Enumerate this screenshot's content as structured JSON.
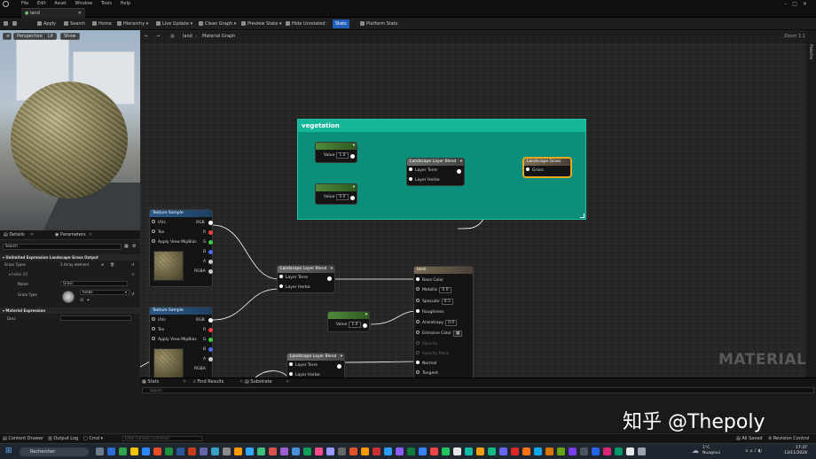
{
  "menubar": {
    "items": [
      "File",
      "Edit",
      "Asset",
      "Window",
      "Tools",
      "Help"
    ]
  },
  "document_tab": {
    "label": "land"
  },
  "toolbar": {
    "apply": "Apply",
    "search": "Search",
    "home": "Home",
    "hierarchy": "Hierarchy",
    "live_update": "Live Update",
    "clean_graph": "Clean Graph",
    "preview_state": "Preview State",
    "hide_unrelated": "Hide Unrelated",
    "stats": "Stats",
    "platform_stats": "Platform Stats"
  },
  "viewport": {
    "perspective": "Perspective",
    "lit": "Lit",
    "show": "Show"
  },
  "details_panel": {
    "tab_details": "Details",
    "tab_parameters": "Parameters",
    "search_placeholder": "Search",
    "section_main": "Unlimited Expression Landscape Grass Output",
    "grass_types_label": "Grass Types",
    "grass_types_value": "1 Array element",
    "index_label": "Index [0]",
    "name_label": "Name",
    "name_value": "Grass",
    "grass_type_label": "Grass Type",
    "grass_type_value": "herbe",
    "section_expression": "Material Expression",
    "desc_label": "Desc"
  },
  "graph": {
    "breadcrumb_root": "land",
    "breadcrumb_current": "Material Graph",
    "zoom": "Zoom 1:1",
    "palette": "Palette",
    "watermark": "MATERIAL"
  },
  "comment_box": {
    "title": "vegetation"
  },
  "nodes": {
    "const1": {
      "pin": "Value",
      "value": "1.0"
    },
    "const2": {
      "pin": "Value",
      "value": "0.0"
    },
    "const3": {
      "pin": "Value",
      "value": "1.0"
    },
    "blend_top": {
      "title": "Landscape Layer Blend",
      "pin1": "Layer Terre",
      "pin2": "Layer Herbe"
    },
    "blend_mid": {
      "title": "Landscape Layer Blend",
      "pin1": "Layer Terre",
      "pin2": "Layer Herbe"
    },
    "blend_bot": {
      "title": "Landscape Layer Blend",
      "pin1": "Layer Terre",
      "pin2": "Layer Herbe"
    },
    "grass_out": {
      "title": "Landscape Grass",
      "pin": "Grass"
    },
    "tex1": {
      "title": "Texture Sample",
      "uvs": "UVs",
      "tex": "Tex",
      "apply_mip": "Apply View MipBias",
      "rgb": "RGB",
      "r": "R",
      "g": "G",
      "b": "B",
      "a": "A",
      "rgba": "RGBA"
    },
    "tex2": {
      "title": "Texture Sample",
      "uvs": "UVs",
      "tex": "Tex",
      "apply_mip": "Apply View MipBias",
      "rgb": "RGB",
      "r": "R",
      "g": "G",
      "b": "B",
      "a": "A",
      "rgba": "RGBA"
    },
    "material": {
      "title": "land",
      "base_color": "Base Color",
      "metallic": "Metallic",
      "metallic_val": "0.0",
      "specular": "Specular",
      "specular_val": "0.5",
      "roughness": "Roughness",
      "anisotropy": "Anisotropy",
      "anisotropy_val": "0.0",
      "emissive": "Emissive Color",
      "opacity": "Opacity",
      "opacity_mask": "Opacity Mask",
      "normal": "Normal",
      "tangent": "Tangent"
    }
  },
  "bottom_panel": {
    "tab_stats": "Stats",
    "tab_find": "Find Results",
    "tab_substrate": "Substrate",
    "search_placeholder": "Search"
  },
  "watermark_text": "知乎 @Thepoly",
  "status_bar": {
    "content_drawer": "Content Drawer",
    "output_log": "Output Log",
    "cmd": "Cmd",
    "console_placeholder": "Enter Console Command",
    "all_saved": "All Saved",
    "revision_control": "Revision Control"
  },
  "taskbar": {
    "search": "Rechercher",
    "weather_temp": "1°C",
    "weather_desc": "Nuageux",
    "time": "17:37",
    "date": "13/11/2024"
  },
  "colors": {
    "comment_body": "#0b8f7b",
    "comment_header": "#16b69a",
    "selection": "#e8a820",
    "stats_active": "#1f5fb6"
  }
}
